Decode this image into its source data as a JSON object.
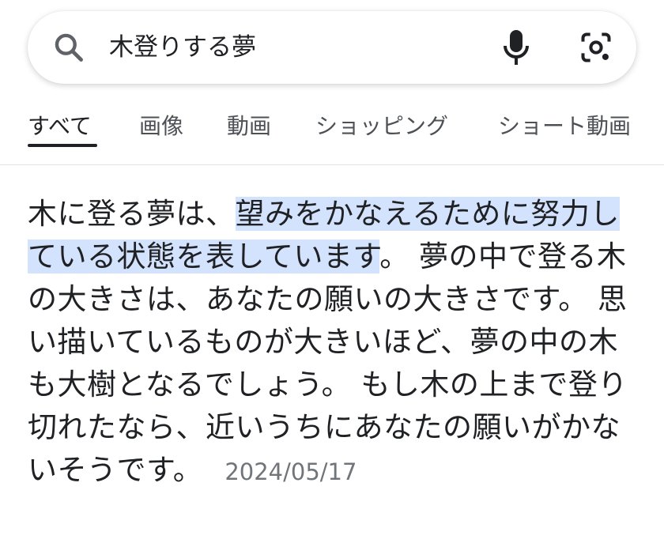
{
  "search": {
    "query": "木登りする夢"
  },
  "tabs": [
    {
      "label": "すべて",
      "active": true
    },
    {
      "label": "画像",
      "active": false
    },
    {
      "label": "動画",
      "active": false
    },
    {
      "label": "ショッピング",
      "active": false
    },
    {
      "label": "ショート動画",
      "active": false
    }
  ],
  "snippet": {
    "part1": "木に登る夢は、",
    "highlight": "望みをかなえるために努力している状態を表しています",
    "part2": "。 夢の中で登る木の大きさは、あなたの願いの大きさです。 思い描いているものが大きいほど、夢の中の木も大樹となるでしょう。 もし木の上まで登り切れたなら、近いうちにあなたの願いがかないそうです。",
    "date": "2024/05/17"
  },
  "colors": {
    "highlight": "#d3e3fd",
    "text": "#202124",
    "secondary": "#70757a"
  }
}
